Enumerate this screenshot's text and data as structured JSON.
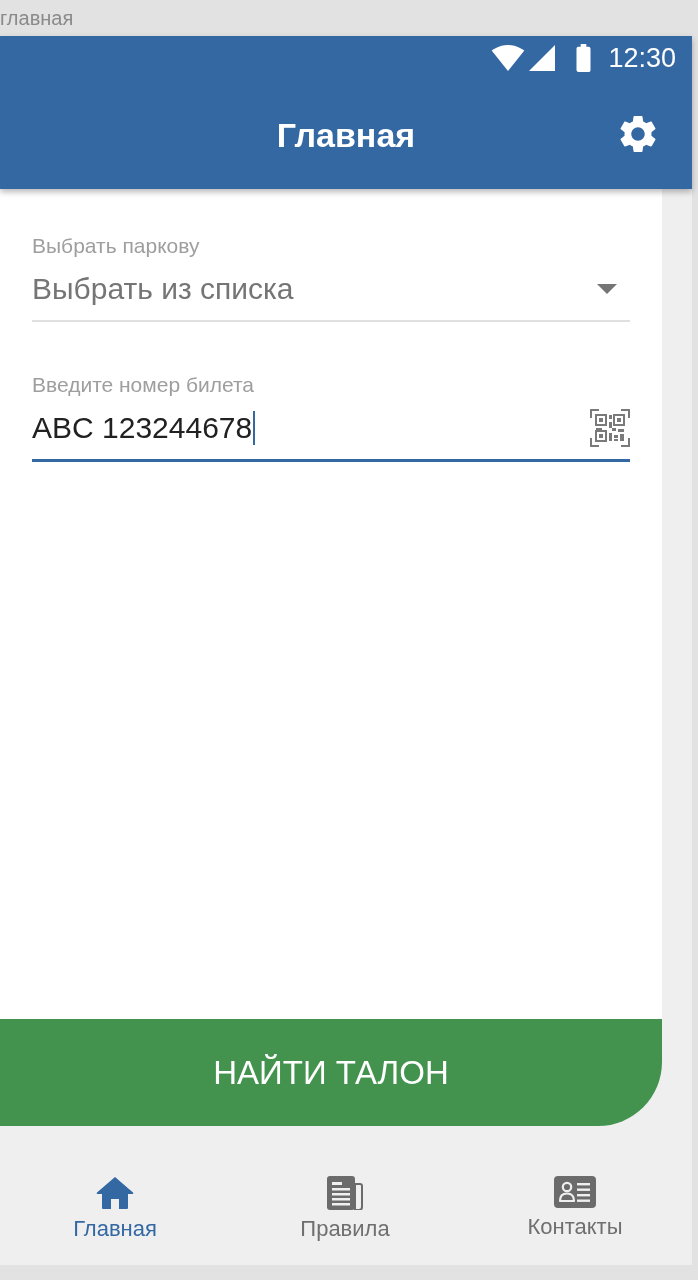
{
  "page_caption": "главная",
  "status_bar": {
    "time": "12:30"
  },
  "app_bar": {
    "title": "Главная"
  },
  "form": {
    "parking": {
      "label": "Выбрать паркову",
      "value": "Выбрать из списка"
    },
    "ticket": {
      "label": "Введите номер билета",
      "value": "ABC 123244678",
      "focused": true
    }
  },
  "action_button": {
    "label": "НАЙТИ ТАЛОН"
  },
  "bottom_nav": [
    {
      "kind": "home",
      "label": "Главная",
      "selected": true
    },
    {
      "kind": "rules",
      "label": "Правила",
      "selected": false
    },
    {
      "kind": "contacts",
      "label": "Контакты",
      "selected": false
    }
  ]
}
